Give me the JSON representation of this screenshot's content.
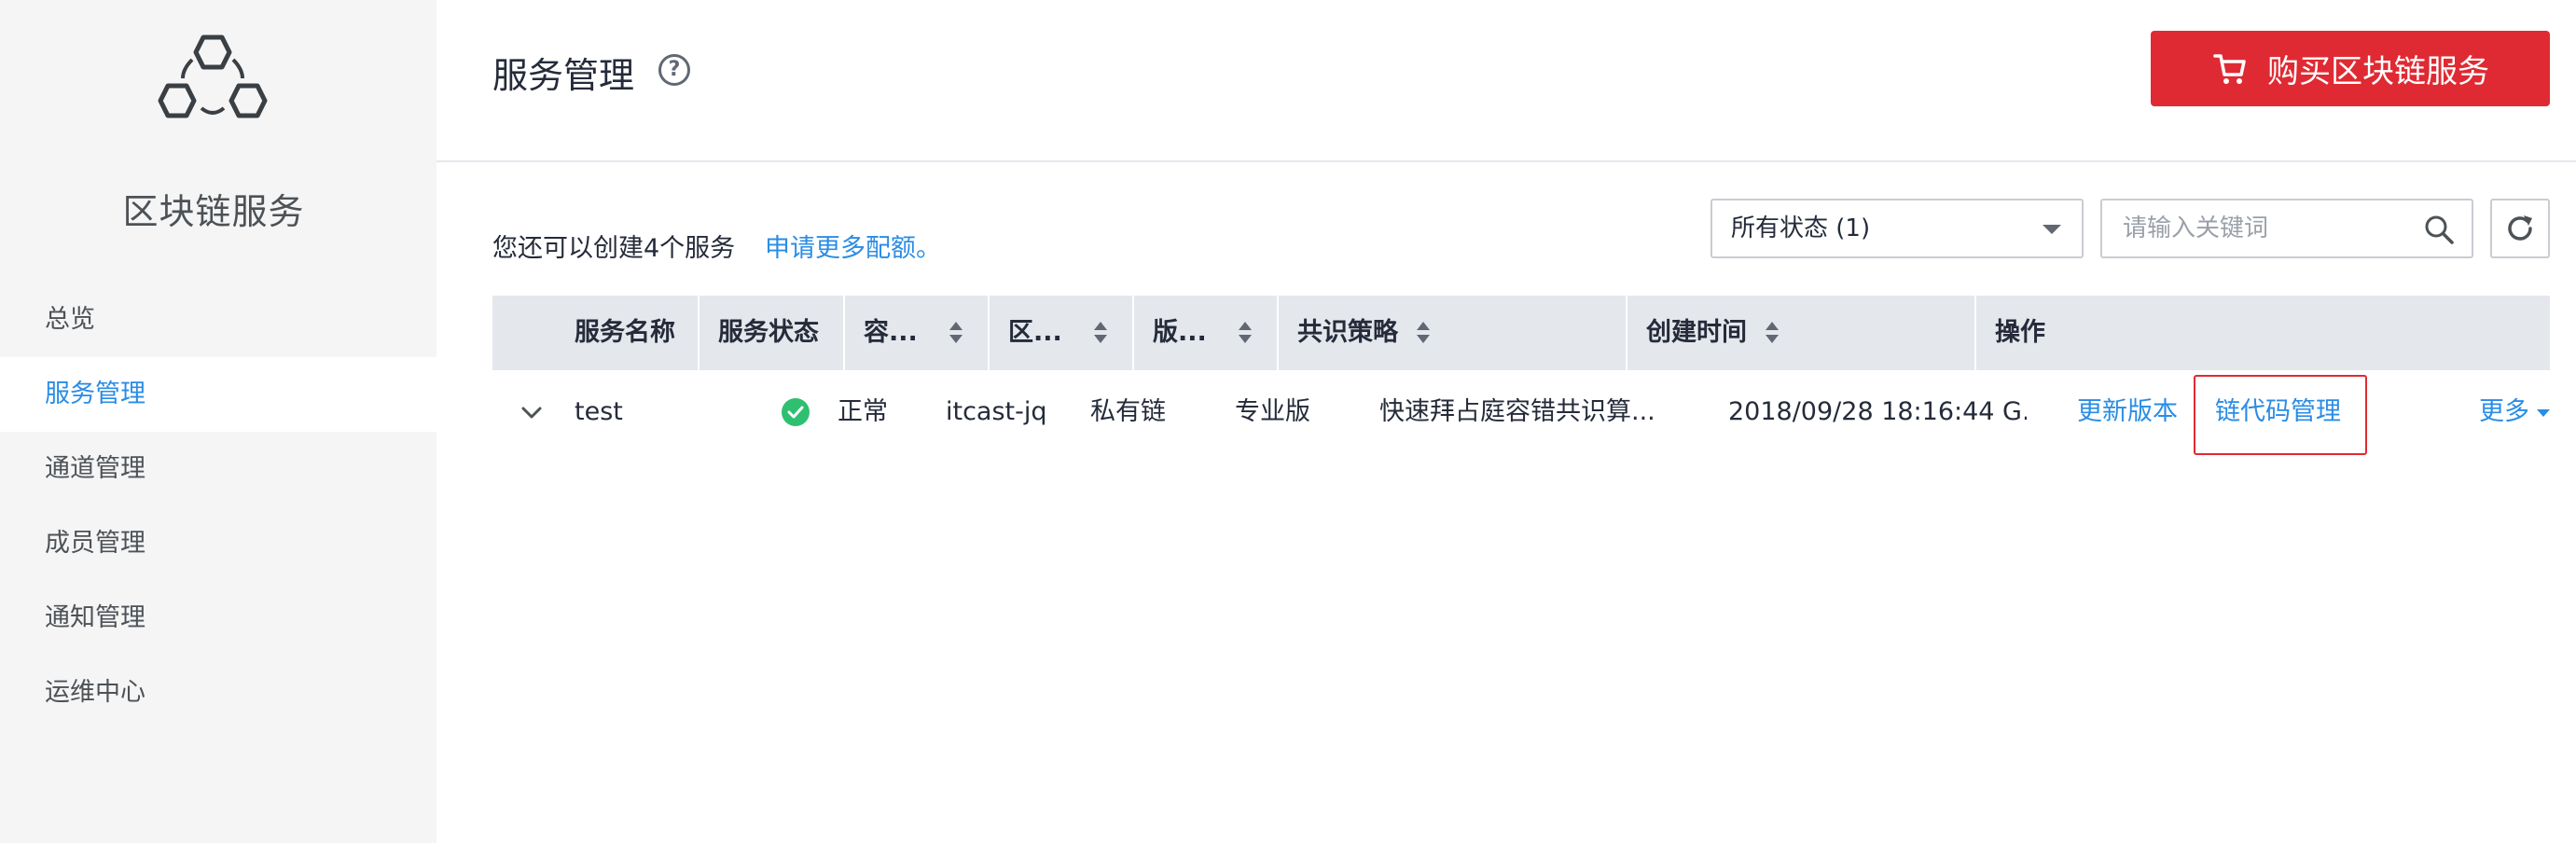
{
  "sidebar": {
    "brand": "区块链服务",
    "items": [
      {
        "label": "总览"
      },
      {
        "label": "服务管理"
      },
      {
        "label": "通道管理"
      },
      {
        "label": "成员管理"
      },
      {
        "label": "通知管理"
      },
      {
        "label": "运维中心"
      }
    ],
    "active_index": 1
  },
  "header": {
    "title": "服务管理",
    "help_icon": "?",
    "buy_button_label": "购买区块链服务",
    "buy_button_color": "#e02a33"
  },
  "quota": {
    "text": "您还可以创建4个服务",
    "link": "申请更多配额。"
  },
  "filters": {
    "status_selected": "所有状态 (1)",
    "search_placeholder": "请输入关键词"
  },
  "table": {
    "columns": [
      "服务名称",
      "服务状态",
      "容...",
      "区...",
      "版...",
      "共识策略",
      "创建时间",
      "操作"
    ],
    "rows": [
      {
        "name": "test",
        "status": "正常",
        "container": "itcast-jq",
        "chain_type": "私有链",
        "edition": "专业版",
        "consensus": "快速拜占庭容错共识算...",
        "created": "2018/09/28 18:16:44 G...",
        "actions": {
          "update": "更新版本",
          "chaincode": "链代码管理",
          "more": "更多"
        }
      }
    ]
  },
  "colors": {
    "accent": "#2a8ce5",
    "status_ok": "#2fbf71",
    "highlight": "#e02a33"
  }
}
